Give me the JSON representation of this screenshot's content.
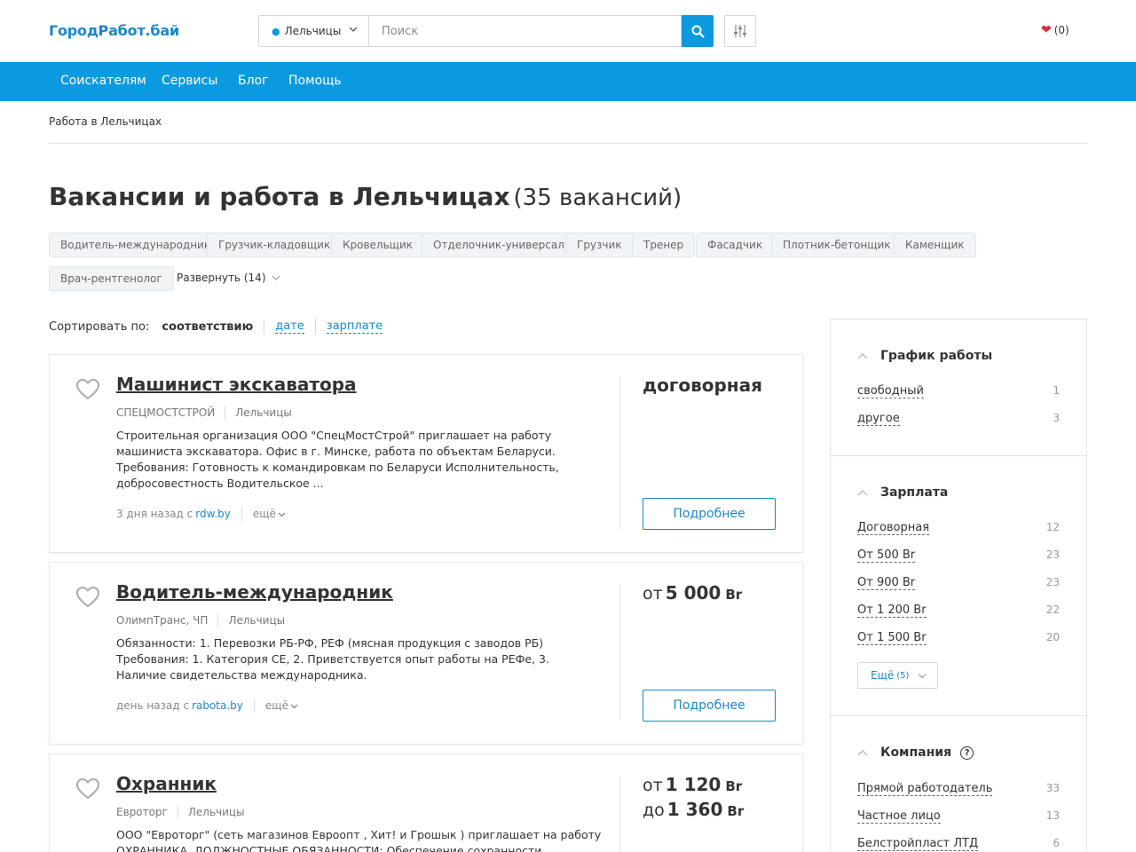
{
  "header": {
    "logo": "ГородРабот.бай",
    "city": "Лельчицы",
    "search_placeholder": "Поиск",
    "favorites_count": "(0)"
  },
  "nav": {
    "items": [
      "Соискателям",
      "Сервисы",
      "Блог",
      "Помощь"
    ]
  },
  "breadcrumb": "Работа в Лельчицах",
  "page": {
    "title": "Вакансии и работа в Лельчицах",
    "count": "(35 вакансий)"
  },
  "tags": [
    "Водитель-международник",
    "Грузчик-кладовщик",
    "Кровельщик",
    "Отделочник-универсал",
    "Грузчик",
    "Тренер",
    "Фасадчик",
    "Плотник-бетонщик",
    "Каменщик",
    "Врач-рентгенолог"
  ],
  "expand_label": "Развернуть (14)",
  "sort": {
    "label": "Сортировать по:",
    "selected": "соответствию",
    "options": [
      "дате",
      "зарплате"
    ]
  },
  "vacancies": [
    {
      "title": "Машинист экскаватора",
      "company": "СПЕЦМОСТСТРОЙ",
      "city": "Лельчицы",
      "description": "Строительная организация ООО \"СпецМостСтрой\" приглашает на работу машиниста экскаватора. Офис в г. Минске, работа по объектам Беларуси. Требования: Готовность к командировкам по Беларуси Исполнительность, добросовестность Водительское ...",
      "posted": "3 дня назад с",
      "source": "rdw.by",
      "more": "ещё",
      "salary_text": "договорная",
      "button": "Подробнее"
    },
    {
      "title": "Водитель-международник",
      "company": "ОлимпТранс, ЧП",
      "city": "Лельчицы",
      "description": "Обязанности: 1. Перевозки РБ-РФ, РЕФ (мясная продукция с заводов РБ) Требования: 1. Категория СЕ, 2. Приветствуется опыт работы на РЕФе, 3. Наличие свидетельства международника.",
      "posted": "день назад с",
      "source": "rabota.by",
      "more": "ещё",
      "salary_prefix": "от",
      "salary_value": "5 000",
      "currency": "Br",
      "button": "Подробнее"
    },
    {
      "title": "Охранник",
      "company": "Евроторг",
      "city": "Лельчицы",
      "description": "ООО \"Евроторг\" (сеть магазинов Евроопт , Хит! и Грошык ) приглашает на работу ОХРАННИКА. ДОЛЖНОСТНЫЕ ОБЯЗАННОСТИ: Обеспечение сохранности имущества",
      "salary_from_prefix": "от",
      "salary_from": "1 120",
      "salary_to_prefix": "до",
      "salary_to": "1 360",
      "currency": "Br"
    }
  ],
  "sidebar": {
    "schedule": {
      "title": "График работы",
      "items": [
        {
          "label": "свободный",
          "count": "1"
        },
        {
          "label": "другое",
          "count": "3"
        }
      ]
    },
    "salary": {
      "title": "Зарплата",
      "items": [
        {
          "label": "Договорная",
          "count": "12"
        },
        {
          "label": "От 500 Br",
          "count": "23"
        },
        {
          "label": "От 900 Br",
          "count": "23"
        },
        {
          "label": "От 1 200 Br",
          "count": "22"
        },
        {
          "label": "От 1 500 Br",
          "count": "20"
        }
      ],
      "more_label": "Ещё",
      "more_count": "(5)"
    },
    "company": {
      "title": "Компания",
      "help": "?",
      "items": [
        {
          "label": "Прямой работодатель",
          "count": "33"
        },
        {
          "label": "Частное лицо",
          "count": "13"
        },
        {
          "label": "Белстройпласт ЛТД",
          "count": "6"
        }
      ]
    }
  },
  "colors": {
    "accent": "#0b9ae0",
    "link": "#1a88c9",
    "heart": "#d9313f"
  },
  "icons": [
    "location-pin-icon",
    "chevron-down-icon",
    "search-icon",
    "filter-sliders-icon",
    "heart-icon",
    "heart-outline-icon",
    "chevron-up-icon",
    "help-icon"
  ]
}
